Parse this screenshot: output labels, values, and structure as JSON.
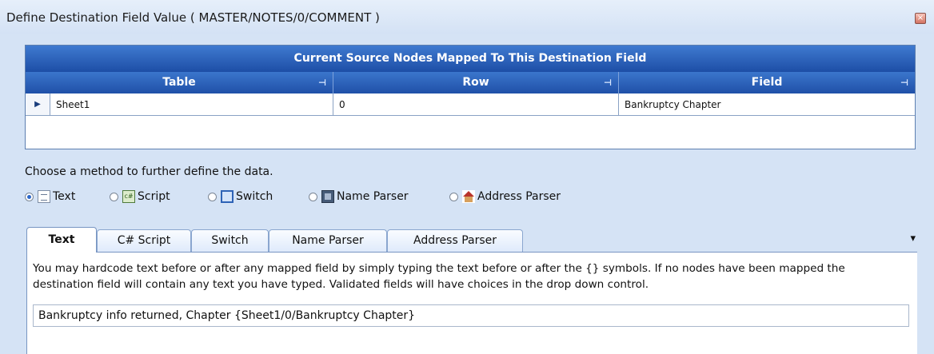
{
  "window": {
    "title": "Define Destination Field Value ( MASTER/NOTES/0/COMMENT )",
    "close_glyph": "×"
  },
  "grid": {
    "caption": "Current Source Nodes Mapped To This Destination Field",
    "columns": [
      "Table",
      "Row",
      "Field"
    ],
    "pin_glyph": "⊣",
    "current_row_glyph": "▶",
    "rows": [
      {
        "table": "Sheet1",
        "row": "0",
        "field": "Bankruptcy Chapter"
      }
    ]
  },
  "method": {
    "prompt": "Choose a method to further define the data.",
    "selected": "Text",
    "options": [
      {
        "label": "Text",
        "icon": "text-icon"
      },
      {
        "label": "Script",
        "icon": "csharp-script-icon"
      },
      {
        "label": "Switch",
        "icon": "switch-icon"
      },
      {
        "label": "Name Parser",
        "icon": "name-parser-icon"
      },
      {
        "label": "Address Parser",
        "icon": "address-parser-icon"
      }
    ]
  },
  "tabs": {
    "items": [
      "Text",
      "C# Script",
      "Switch",
      "Name Parser",
      "Address Parser"
    ],
    "active": "Text",
    "menu_glyph": "▾"
  },
  "text_panel": {
    "hint": "You may hardcode text before or after any mapped field by simply typing the text before or after the {} symbols.  If no nodes have been mapped the destination field will contain any text you have typed. Validated fields will have choices in the drop down control.",
    "value": "Bankruptcy info returned, Chapter {Sheet1/0/Bankruptcy Chapter}"
  },
  "colors": {
    "header_blue": "#1d4ea6",
    "window_bg": "#d5e3f5",
    "radio_accent": "#2b67c9"
  }
}
